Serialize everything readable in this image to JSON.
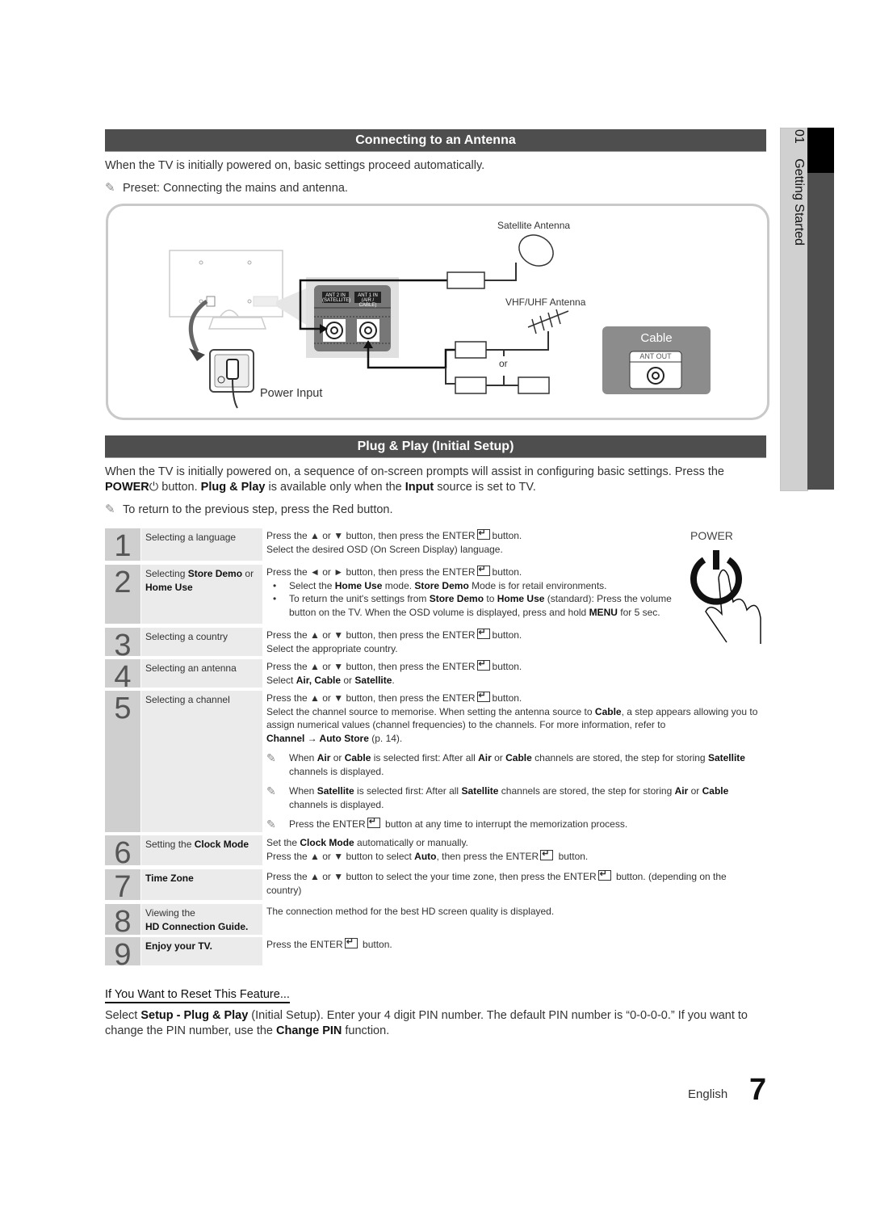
{
  "sidebar": {
    "chapter_number": "01",
    "chapter_title": "Getting Started"
  },
  "section1": {
    "title": "Connecting to an Antenna",
    "intro": "When the TV is initially powered on, basic settings proceed automatically.",
    "note": "Preset: Connecting the mains and antenna.",
    "diagram": {
      "satellite_label": "Satellite Antenna",
      "vhf_label": "VHF/UHF Antenna",
      "ant2_label": "ANT 2 IN",
      "ant2_sub": "(SATELLITE)",
      "ant1_label": "ANT 1 IN",
      "ant1_sub": "(AIR / CABLE)",
      "or_label": "or",
      "cable_label": "Cable",
      "ant_out_label": "ANT OUT",
      "power_input_label": "Power Input"
    }
  },
  "section2": {
    "title": "Plug & Play (Initial Setup)",
    "intro_1": "When the TV is initially powered on, a sequence of on-screen prompts will assist in configuring basic settings. Press the",
    "intro_power": "POWER",
    "intro_2": " button. ",
    "intro_pp": "Plug & Play",
    "intro_3": " is available only when the ",
    "intro_input": "Input",
    "intro_4": " source is set to TV.",
    "note": "To return to the previous step, press the Red button.",
    "power_label": "POWER"
  },
  "steps": [
    {
      "num": "1",
      "title": "Selecting a language",
      "lines": [
        "Press the ▲ or ▼ button, then press the ENTER",
        "button.",
        "Select the desired OSD (On Screen Display) language."
      ]
    },
    {
      "num": "2",
      "title_a": "Selecting ",
      "title_b": "Store Demo",
      "title_c": " or",
      "title_d": "Home Use",
      "line1": "Press the ◄ or ► button, then press the ENTER",
      "line1b": "button.",
      "bullet1": [
        "Select the ",
        "Home Use",
        " mode. ",
        "Store Demo",
        " Mode is for retail environments."
      ],
      "bullet2": [
        "To return the unit's settings from ",
        "Store Demo",
        " to ",
        "Home Use",
        " (standard): Press the volume button on the TV. When the OSD volume is displayed, press and hold ",
        "MENU",
        " for 5 sec."
      ]
    },
    {
      "num": "3",
      "title": "Selecting a country",
      "lines": [
        "Press the ▲ or ▼ button, then press the ENTER",
        "button.",
        "Select the appropriate country."
      ]
    },
    {
      "num": "4",
      "title": "Selecting an antenna",
      "lines": [
        "Press the ▲ or ▼ button, then press the ENTER",
        "button."
      ],
      "line2": [
        "Select ",
        "Air, Cable",
        " or ",
        "Satellite",
        "."
      ]
    },
    {
      "num": "5",
      "title": "Selecting a channel",
      "line1": "Press the ▲ or ▼ button, then press the ENTER",
      "line1b": "button.",
      "para": [
        "Select the channel source to memorise. When setting the antenna source to ",
        "Cable",
        ", a step appears allowing you to assign numerical values (channel frequencies) to the channels. For more information, refer to "
      ],
      "ref": [
        "Channel → Auto Store",
        " (p. 14)."
      ],
      "note1": [
        "When ",
        "Air",
        " or ",
        "Cable",
        " is selected first: After all ",
        "Air",
        " or ",
        "Cable",
        " channels are stored, the step for storing ",
        "Satellite",
        " channels is displayed."
      ],
      "note2": [
        "When ",
        "Satellite",
        " is selected first: After all ",
        "Satellite",
        " channels are stored, the step for storing ",
        "Air",
        " or ",
        "Cable",
        " channels is displayed."
      ],
      "note3": [
        "Press the ENTER",
        " button at any time to interrupt the memorization process."
      ]
    },
    {
      "num": "6",
      "title_a": "Setting the ",
      "title_b": "Clock Mode",
      "line1": [
        "Set the ",
        "Clock Mode",
        " automatically or manually."
      ],
      "line2": [
        "Press the ▲ or ▼ button to select ",
        "Auto",
        ", then press the ENTER",
        " button."
      ]
    },
    {
      "num": "7",
      "title": "Time Zone",
      "line1": [
        "Press the ▲ or ▼ button to select the your time zone, then press the ENTER",
        " button. (depending on the country)"
      ]
    },
    {
      "num": "8",
      "title_a": "Viewing the",
      "title_b": "HD Connection Guide.",
      "line1": "The connection method for the best HD screen quality is displayed."
    },
    {
      "num": "9",
      "title": "Enjoy your TV.",
      "line1": [
        "Press the ENTER",
        " button."
      ]
    }
  ],
  "reset": {
    "heading": "If You Want to Reset This Feature...",
    "text": [
      "Select ",
      "Setup - Plug & Play",
      " (Initial Setup). Enter your 4 digit PIN number. The default PIN number is “0-0-0-0.” If you want to change the PIN number, use the ",
      "Change PIN",
      " function."
    ]
  },
  "footer": {
    "language": "English",
    "page_number": "7"
  },
  "colors": {
    "header_bg": "#4e4e4e",
    "step_num_bg": "#cfcfcf",
    "step_title_bg": "#ebebeb",
    "side_tab_light": "#d0d0d0",
    "side_tab_dark": "#4e4e4e"
  }
}
